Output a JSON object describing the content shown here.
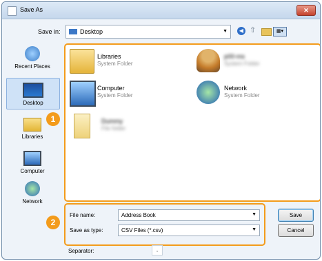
{
  "window": {
    "title": "Save As",
    "close_glyph": "✕"
  },
  "toolbar": {
    "save_in_label": "Save in:",
    "save_in_value": "Desktop",
    "icons": [
      "back-icon",
      "up-folder-icon",
      "new-folder-icon",
      "views-menu-icon"
    ]
  },
  "places": [
    {
      "label": "Recent Places",
      "icon": "recent-places-icon"
    },
    {
      "label": "Desktop",
      "icon": "desktop-icon",
      "selected": true
    },
    {
      "label": "Libraries",
      "icon": "libraries-icon"
    },
    {
      "label": "Computer",
      "icon": "computer-icon"
    },
    {
      "label": "Network",
      "icon": "network-icon"
    }
  ],
  "files": [
    {
      "name": "Libraries",
      "type": "System Folder"
    },
    {
      "name": "p00-ms",
      "type": "System Folder"
    },
    {
      "name": "Computer",
      "type": "System Folder"
    },
    {
      "name": "Network",
      "type": "System Folder"
    },
    {
      "name": "Dummy",
      "type": "File folder"
    }
  ],
  "form": {
    "file_name_label": "File name:",
    "file_name_value": "Address Book",
    "save_as_type_label": "Save as type:",
    "save_as_type_value": "CSV Files (*.csv)",
    "separator_label": "Separator:",
    "separator_value": ","
  },
  "buttons": {
    "save": "Save",
    "cancel": "Cancel"
  },
  "callouts": [
    "1",
    "2"
  ],
  "accent_color": "#f39b1b"
}
